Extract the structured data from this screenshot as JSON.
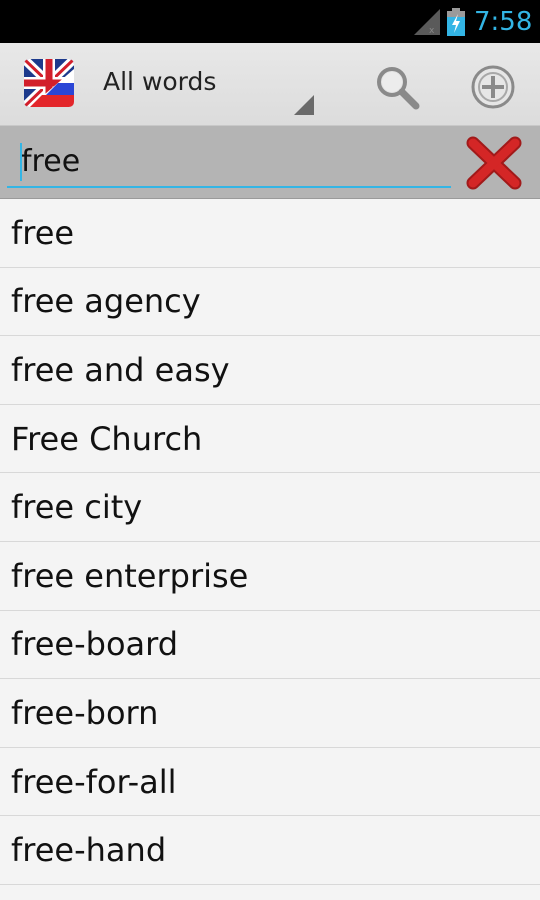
{
  "status_bar": {
    "time": "7:58",
    "icons": [
      "signal-icon",
      "battery-charging-icon"
    ],
    "accent_color": "#33b5e5"
  },
  "action_bar": {
    "flag_icon": "uk-russia-flag-icon",
    "mode_selected": "All words",
    "search_icon": "search-icon",
    "add_icon": "add-circle-icon"
  },
  "search": {
    "value": "free",
    "clear_icon": "red-x-icon"
  },
  "words": [
    "free",
    "free agency",
    "free and easy",
    "Free Church",
    "free city",
    "free enterprise",
    "free-board",
    "free-born",
    "free-for-all",
    "free-hand"
  ]
}
